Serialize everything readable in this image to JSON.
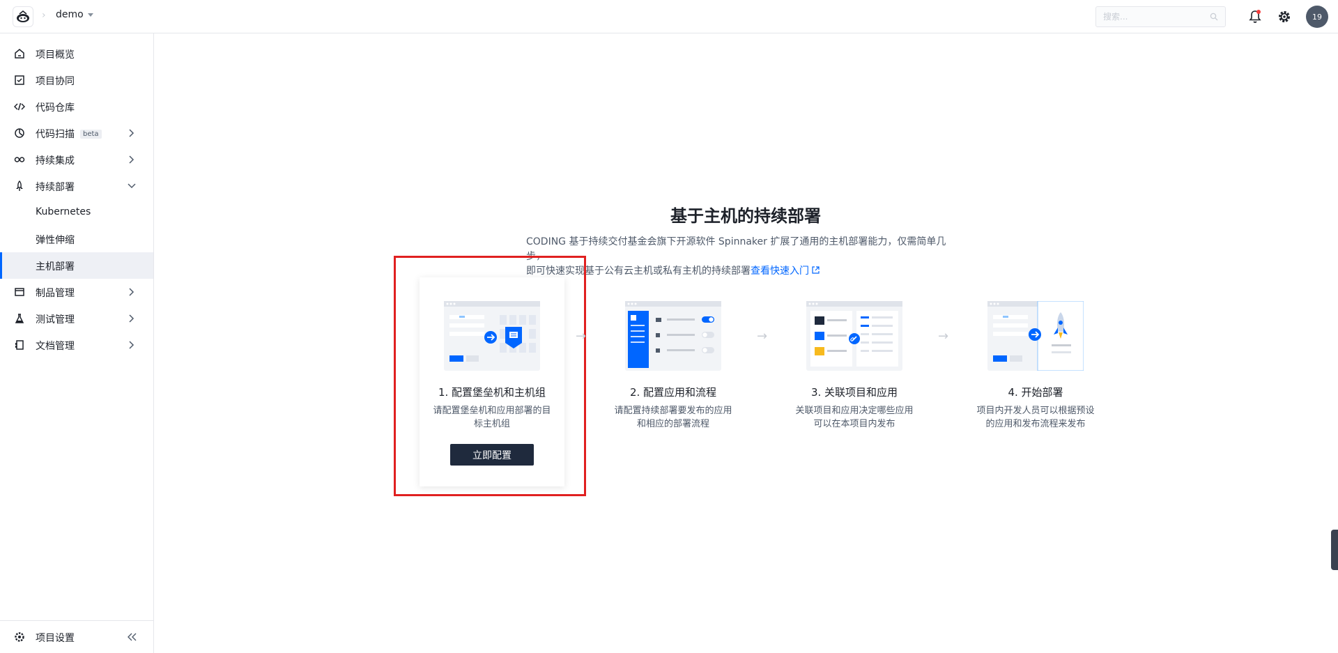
{
  "topbar": {
    "project_name": "demo",
    "search_placeholder": "搜索...",
    "avatar_text": "19"
  },
  "sidebar": {
    "items": [
      {
        "label": "项目概览",
        "icon": "home-icon"
      },
      {
        "label": "项目协同",
        "icon": "checkbox-icon"
      },
      {
        "label": "代码仓库",
        "icon": "code-icon"
      },
      {
        "label": "代码扫描",
        "badge": "beta",
        "icon": "scan-icon"
      },
      {
        "label": "持续集成",
        "icon": "infinity-icon"
      },
      {
        "label": "持续部署",
        "icon": "rocket-icon"
      },
      {
        "label": "Kubernetes"
      },
      {
        "label": "弹性伸缩"
      },
      {
        "label": "主机部署"
      },
      {
        "label": "制品管理",
        "icon": "box-icon"
      },
      {
        "label": "测试管理",
        "icon": "flask-icon"
      },
      {
        "label": "文档管理",
        "icon": "book-icon"
      }
    ],
    "footer_label": "项目设置"
  },
  "main": {
    "title": "基于主机的持续部署",
    "desc_line1": "CODING 基于持续交付基金会旗下开源软件 Spinnaker 扩展了通用的主机部署能力，仅需简单几步，",
    "desc_line2": "即可快速实现基于公有云主机或私有主机的持续部署",
    "desc_link": "查看快速入门",
    "steps": [
      {
        "title": "1. 配置堡垒机和主机组",
        "desc": "请配置堡垒机和应用部署的目标主机组",
        "cta": "立即配置"
      },
      {
        "title": "2. 配置应用和流程",
        "desc": "请配置持续部署要发布的应用和相应的部署流程"
      },
      {
        "title": "3. 关联项目和应用",
        "desc": "关联项目和应用决定哪些应用可以在本项目内发布"
      },
      {
        "title": "4. 开始部署",
        "desc": "项目内开发人员可以根据预设的应用和发布流程来发布"
      }
    ],
    "arrow_glyph": "→"
  },
  "colors": {
    "accent": "#0066ff",
    "highlight": "#e02020",
    "cta_bg": "#1f2a3d",
    "active_bg": "#eef0f5"
  }
}
